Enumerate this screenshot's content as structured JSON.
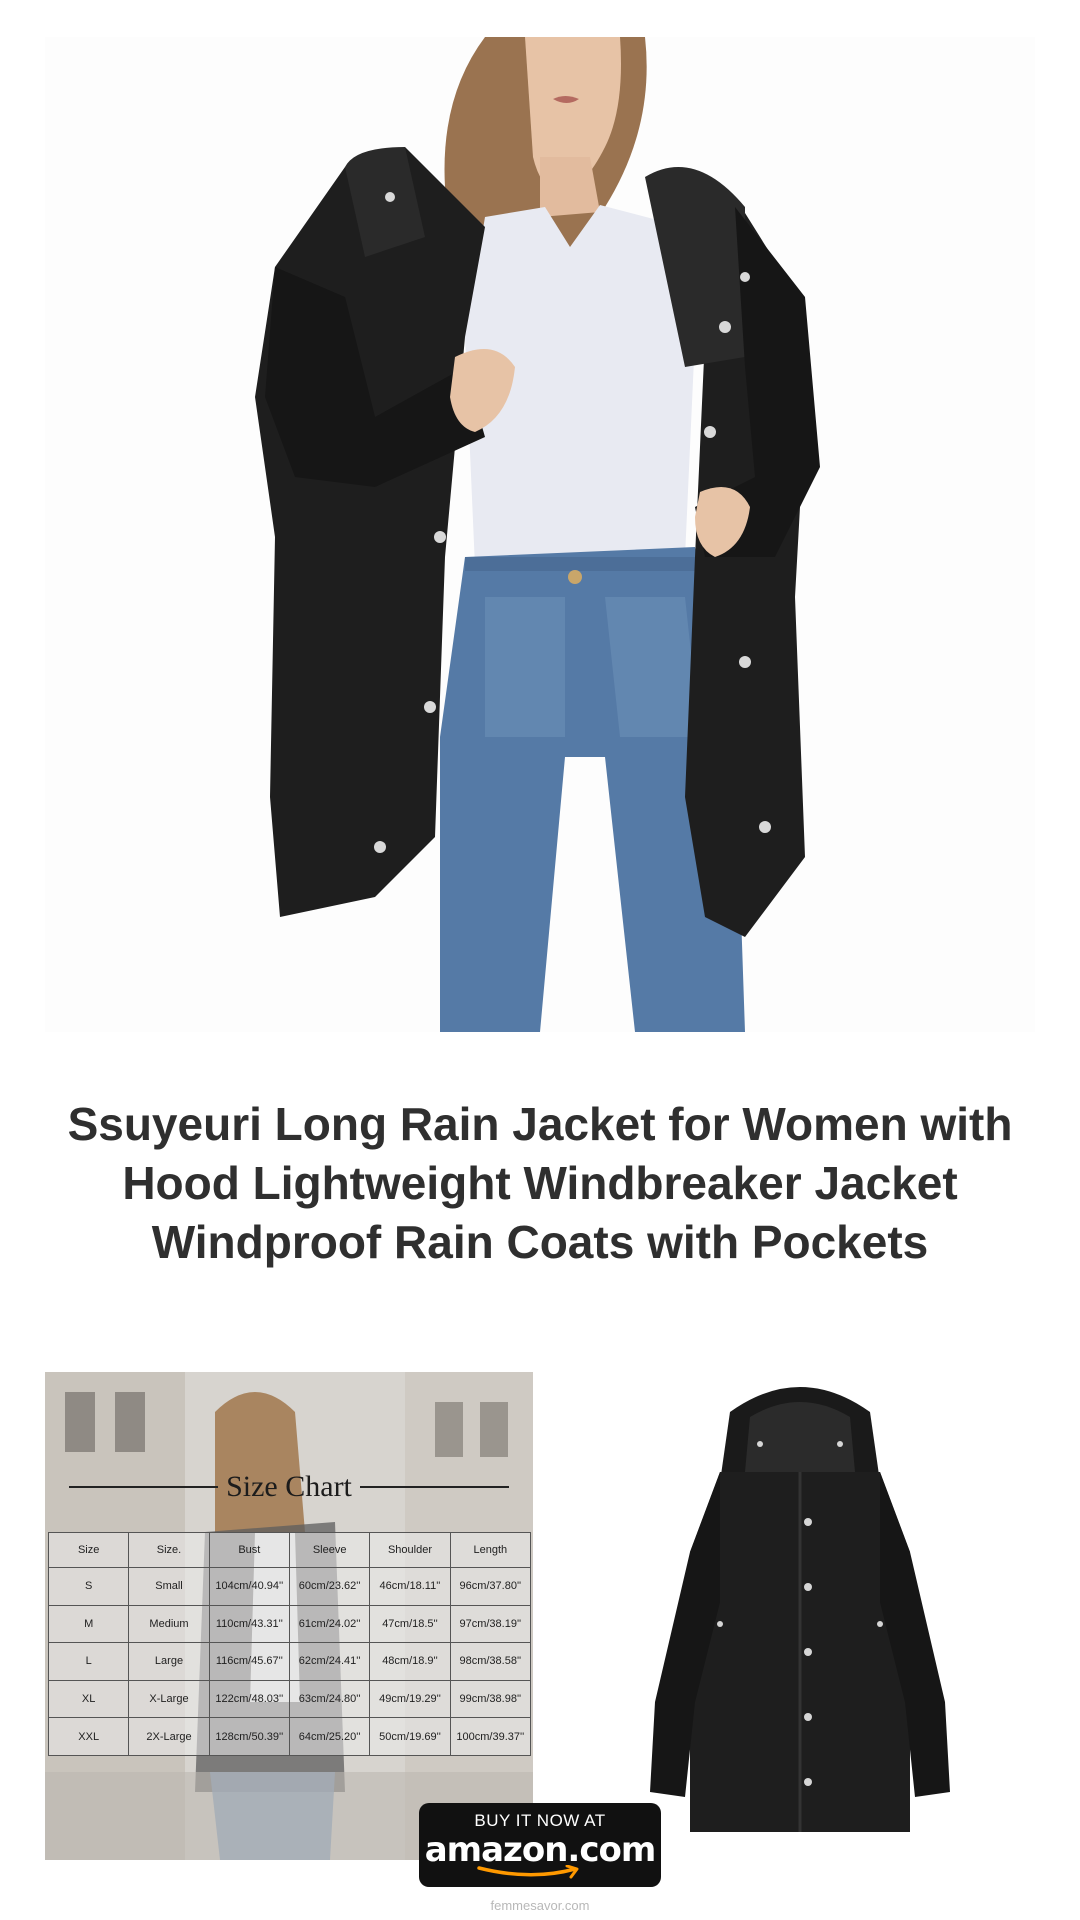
{
  "product": {
    "title": "Ssuyeuri Long Rain Jacket for Women with Hood Lightweight Windbreaker Jacket Windproof Rain Coats with Pockets"
  },
  "size_chart": {
    "heading": "Size Chart",
    "columns": [
      "Size",
      "Size.",
      "Bust",
      "Sleeve",
      "Shoulder",
      "Length"
    ],
    "rows": [
      [
        "S",
        "Small",
        "104cm/40.94''",
        "60cm/23.62''",
        "46cm/18.11''",
        "96cm/37.80''"
      ],
      [
        "M",
        "Medium",
        "110cm/43.31''",
        "61cm/24.02''",
        "47cm/18.5''",
        "97cm/38.19''"
      ],
      [
        "L",
        "Large",
        "116cm/45.67''",
        "62cm/24.41''",
        "48cm/18.9''",
        "98cm/38.58''"
      ],
      [
        "XL",
        "X-Large",
        "122cm/48.03''",
        "63cm/24.80''",
        "49cm/19.29''",
        "99cm/38.98''"
      ],
      [
        "XXL",
        "2X-Large",
        "128cm/50.39''",
        "64cm/25.20''",
        "50cm/19.69''",
        "100cm/39.37''"
      ]
    ]
  },
  "buy_button": {
    "top_label": "BUY IT NOW AT",
    "logo_text": "amazon.com"
  },
  "footer": {
    "site": "femmesavor.com"
  },
  "colors": {
    "jacket": "#1e1e1e",
    "title_text": "#2f2f2f",
    "button_bg": "#111111",
    "amazon_smile": "#f90"
  }
}
